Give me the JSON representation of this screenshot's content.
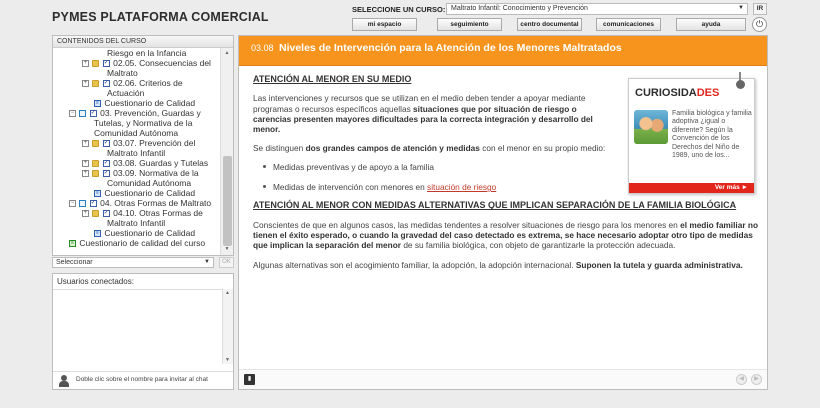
{
  "header": {
    "brand": "PYMES PLATAFORMA COMERCIAL",
    "course_label": "SELECCIONE UN CURSO:",
    "course_value": "Maltrato Infantil: Conocimiento y Prevención",
    "go_label": "IR",
    "nav": [
      "mi espacio",
      "seguimiento",
      "centro documental",
      "comunicaciones",
      "ayuda"
    ],
    "power_icon": "power-icon"
  },
  "sidebar": {
    "title": "CONTENIDOS DEL CURSO",
    "tree": [
      "Riesgo en la Infancia",
      "02.05. Consecuencias del",
      "Maltrato",
      "02.06. Criterios de",
      "Actuación",
      "Cuestionario de Calidad",
      "03. Prevención, Guardas y",
      "Tutelas, y Normativa de la",
      "Comunidad Autónoma",
      "03.07. Prevención del",
      "Maltrato Infantil",
      "03.08. Guardas y Tutelas",
      "03.09. Normativa de la",
      "Comunidad Autónoma",
      "Cuestionario de Calidad",
      "04. Otras Formas de Maltrato",
      "04.10. Otras Formas de",
      "Maltrato Infantil",
      "Cuestionario de Calidad",
      "Cuestionario de calidad del curso"
    ],
    "select_placeholder": "Seleccionar",
    "ok_label": "OK",
    "users_title": "Usuarios conectados:",
    "users_hint": "Doble clic sobre el nombre para invitar al chat"
  },
  "main": {
    "section_number": "03.08",
    "section_title": "Niveles de Intervención para la Atención de los Menores Maltratados",
    "h1": "ATENCIÓN AL MENOR EN SU MEDIO",
    "p1_a": "Las intervenciones y recursos que se utilizan en el medio deben tender a apoyar mediante programas o recursos específicos aquellas ",
    "p1_b": "situaciones que por situación de riesgo o carencias presenten mayores dificultades para la correcta integración y desarrollo del menor.",
    "p2_a": "Se distinguen ",
    "p2_b": "dos grandes campos de atención y medidas",
    "p2_c": " con el menor en su propio medio:",
    "bullet1": "Medidas preventivas y de apoyo a la familia",
    "bullet2_a": "Medidas de intervención con menores en ",
    "bullet2_link": "situación de riesgo",
    "h2": "ATENCIÓN AL MENOR CON MEDIDAS ALTERNATIVAS QUE IMPLICAN SEPARACIÓN DE LA FAMILIA BIOLÓGICA",
    "p3_a": "Conscientes de que en algunos casos, las medidas tendentes a resolver situaciones de riesgo para los menores en ",
    "p3_b": "el medio familiar no tienen el éxito esperado, o cuando la gravedad del caso detectado es extrema, se hace necesario adoptar otro tipo de medidas que implican la separación del menor",
    "p3_c": " de su familia biológica, con objeto de garantizarle la protección adecuada.",
    "p4_a": "Algunas alternativas son el acogimiento familiar, la adopción, la adopción internacional. ",
    "p4_b": "Suponen la tutela y guarda administrativa.",
    "widget": {
      "title_a": "CURIOSIDA",
      "title_b": "DES",
      "text": "Familia biológica y familia adoptiva ¿igual o diferente? Según la Convención de los Derechos del Niño de 1989, uno de los...",
      "more": "Ver más ►"
    }
  },
  "colors": {
    "accent": "#f7941d",
    "link": "#c0392b",
    "widget_red": "#e2261c"
  }
}
